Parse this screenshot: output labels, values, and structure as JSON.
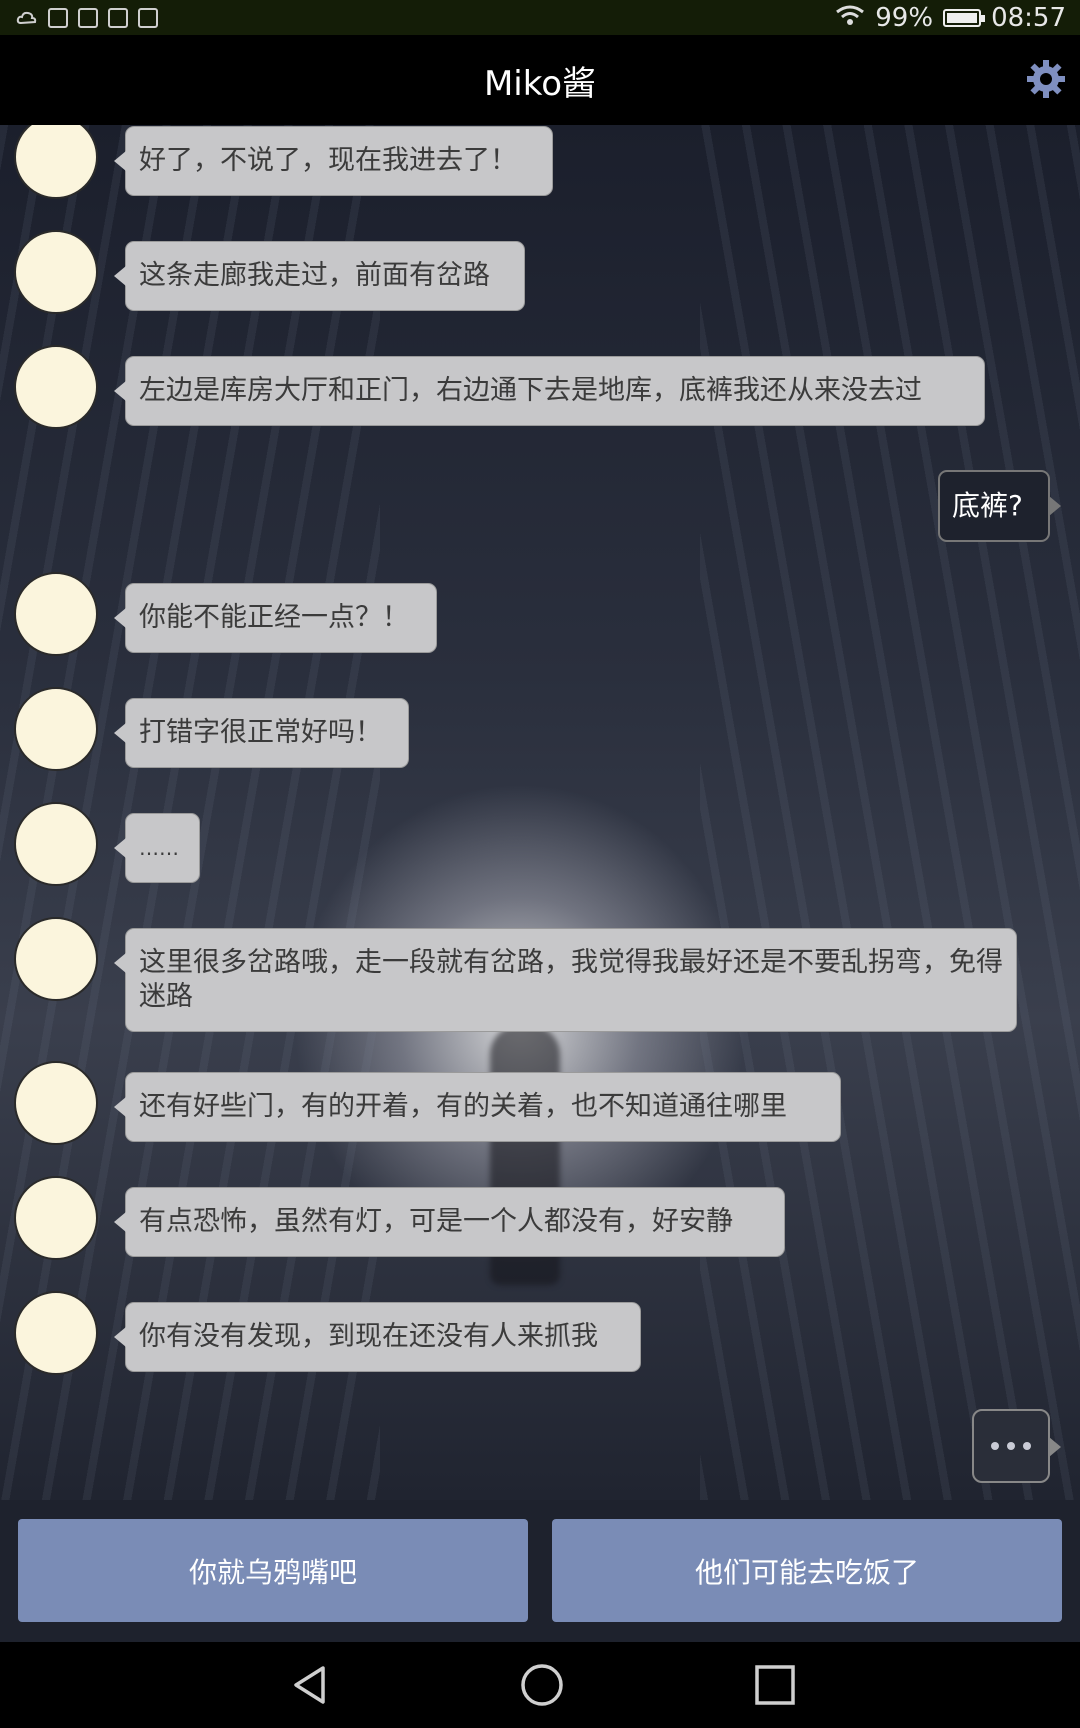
{
  "status_bar": {
    "battery": "99%",
    "battery_level": 0.99,
    "time": "08:57"
  },
  "header": {
    "title": "Miko酱",
    "settings_icon": "gear-icon"
  },
  "colors": {
    "header_bg": "#000000",
    "bubble_left_bg": "#c7c7c9",
    "bubble_right_bg": "#1e222d",
    "reply_button_bg": "#7a8cb6"
  },
  "messages": [
    {
      "sender": "miko",
      "text": "好了，不说了，现在我进去了！"
    },
    {
      "sender": "miko",
      "text": "这条走廊我走过，前面有岔路"
    },
    {
      "sender": "miko",
      "text": "左边是库房大厅和正门，右边通下去是地库，底裤我还从来没去过"
    },
    {
      "sender": "user",
      "text": "底裤?"
    },
    {
      "sender": "miko",
      "text": "你能不能正经一点？！"
    },
    {
      "sender": "miko",
      "text": "打错字很正常好吗！"
    },
    {
      "sender": "miko",
      "text": "……"
    },
    {
      "sender": "miko",
      "text": "这里很多岔路哦，走一段就有岔路，我觉得我最好还是不要乱拐弯，免得迷路"
    },
    {
      "sender": "miko",
      "text": "还有好些门，有的开着，有的关着，也不知道通往哪里"
    },
    {
      "sender": "miko",
      "text": "有点恐怖，虽然有灯，可是一个人都没有，好安静"
    },
    {
      "sender": "miko",
      "text": "你有没有发现，到现在还没有人来抓我"
    }
  ],
  "reply_options": [
    {
      "label": "你就乌鸦嘴吧"
    },
    {
      "label": "他们可能去吃饭了"
    }
  ],
  "nav": {
    "back": "back-icon",
    "home": "home-icon",
    "recents": "recents-icon"
  }
}
